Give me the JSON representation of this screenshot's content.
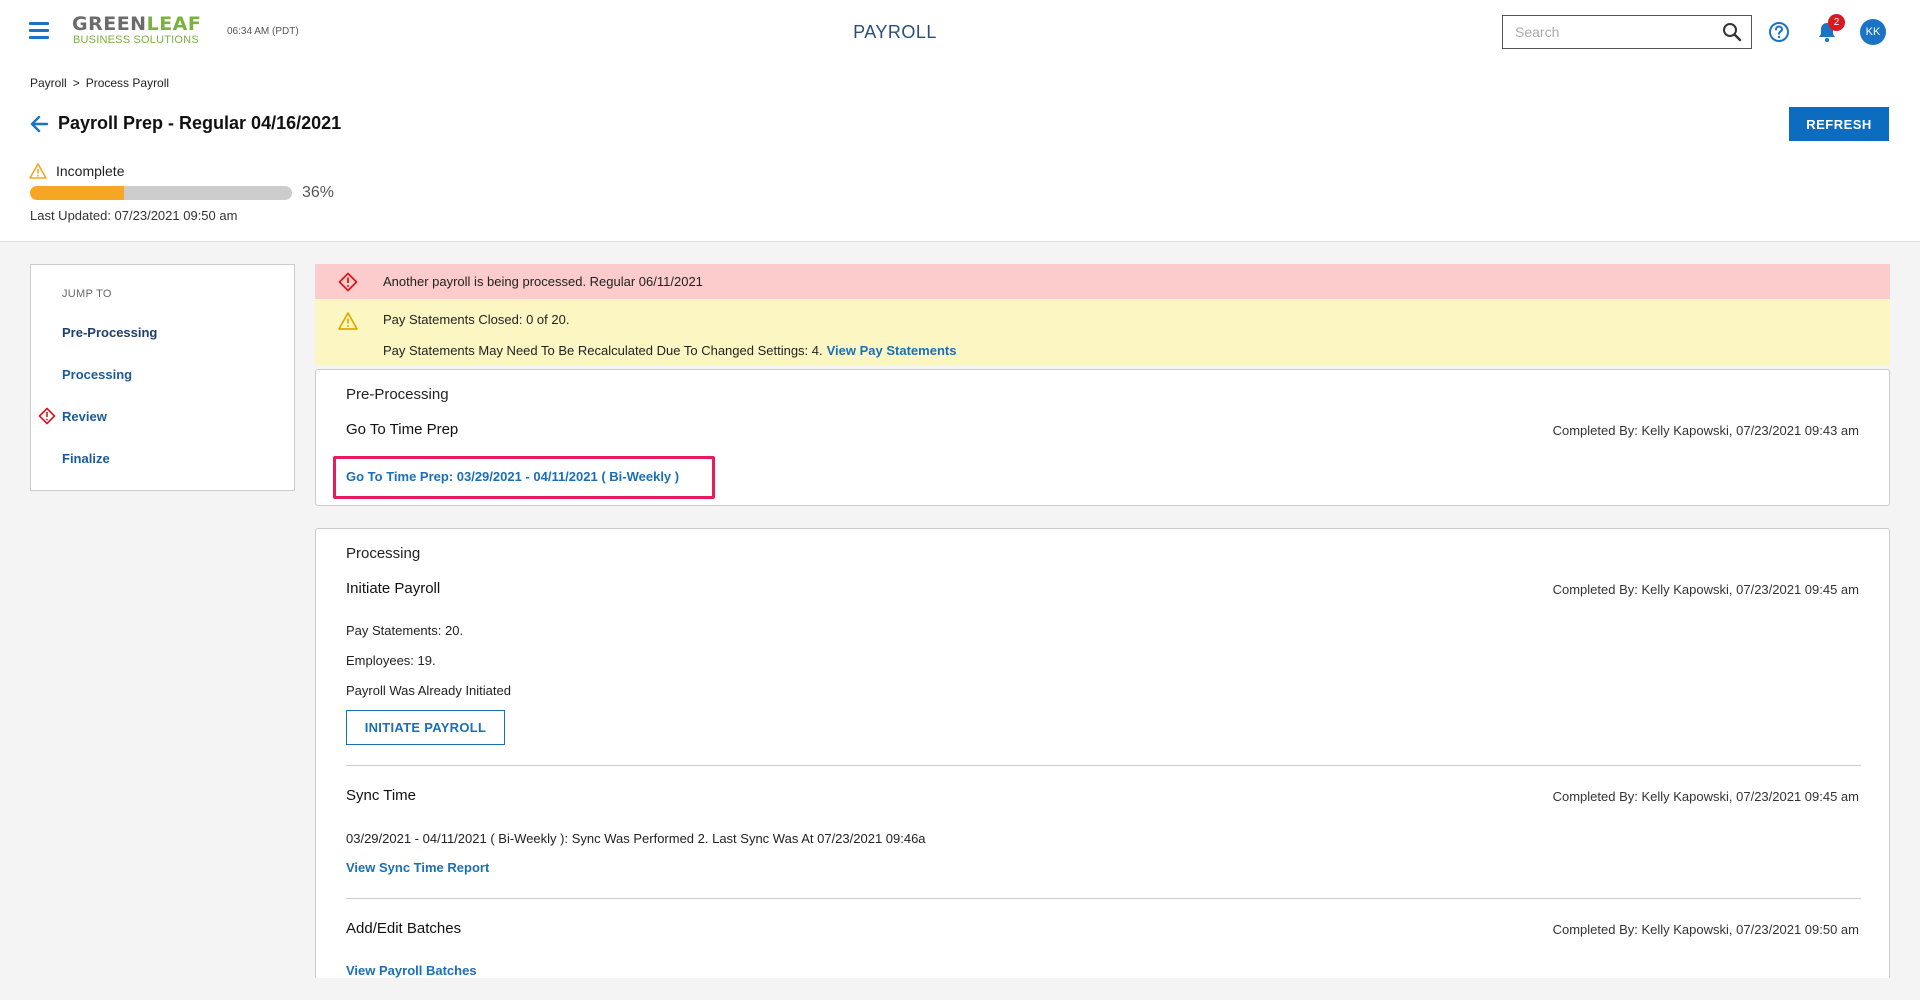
{
  "topbar": {
    "logo_line1_a": "GREEN",
    "logo_line1_b": "LEAF",
    "logo_line2": "BUSINESS SOLUTIONS",
    "clock": "06:34 AM (PDT)",
    "app_title": "PAYROLL",
    "search_placeholder": "Search",
    "notification_count": "2",
    "avatar_initials": "KK"
  },
  "breadcrumb": [
    "Payroll",
    "Process Payroll"
  ],
  "breadcrumb_separator": ">",
  "page": {
    "title": "Payroll Prep - Regular 04/16/2021",
    "refresh_label": "REFRESH",
    "status": "Incomplete",
    "progress_fraction": 0.36,
    "progress_label": "36%",
    "last_updated": "Last Updated: 07/23/2021 09:50 am"
  },
  "jump_to": {
    "title": "JUMP TO",
    "items": [
      {
        "label": "Pre-Processing"
      },
      {
        "label": "Processing"
      },
      {
        "label": "Review"
      },
      {
        "label": "Finalize"
      }
    ]
  },
  "alerts": {
    "error": "Another payroll is being processed. Regular 06/11/2021",
    "warning_line1": "Pay Statements Closed: 0 of 20.",
    "warning_line2": "Pay Statements May Need To Be Recalculated Due To Changed Settings: 4.",
    "warning_link": "View Pay Statements"
  },
  "pre_processing": {
    "heading": "Pre-Processing",
    "step_title": "Go To Time Prep",
    "completed": "Completed By: Kelly Kapowski, 07/23/2021 09:43 am",
    "link": "Go To Time Prep: 03/29/2021 - 04/11/2021 ( Bi-Weekly )"
  },
  "processing": {
    "heading": "Processing",
    "initiate": {
      "title": "Initiate Payroll",
      "completed": "Completed By: Kelly Kapowski, 07/23/2021 09:45 am",
      "pay_statements": "Pay Statements: 20.",
      "employees": "Employees: 19.",
      "status": "Payroll Was Already Initiated",
      "button": "INITIATE PAYROLL"
    },
    "sync": {
      "title": "Sync Time",
      "completed": "Completed By: Kelly Kapowski, 07/23/2021 09:45 am",
      "detail": "03/29/2021 - 04/11/2021 ( Bi-Weekly ): Sync Was Performed 2. Last Sync Was At 07/23/2021 09:46a",
      "link": "View Sync Time Report"
    },
    "batches": {
      "title": "Add/Edit Batches",
      "completed": "Completed By: Kelly Kapowski, 07/23/2021 09:50 am",
      "link": "View Payroll Batches"
    }
  },
  "colors": {
    "primary": "#0b6cc0",
    "link": "#1a6fb7",
    "progress": "#f5a623",
    "error_bg": "#fccbcb",
    "warning_bg": "#fcf7c2",
    "highlight": "#e61c5c",
    "badge": "#d71920"
  }
}
